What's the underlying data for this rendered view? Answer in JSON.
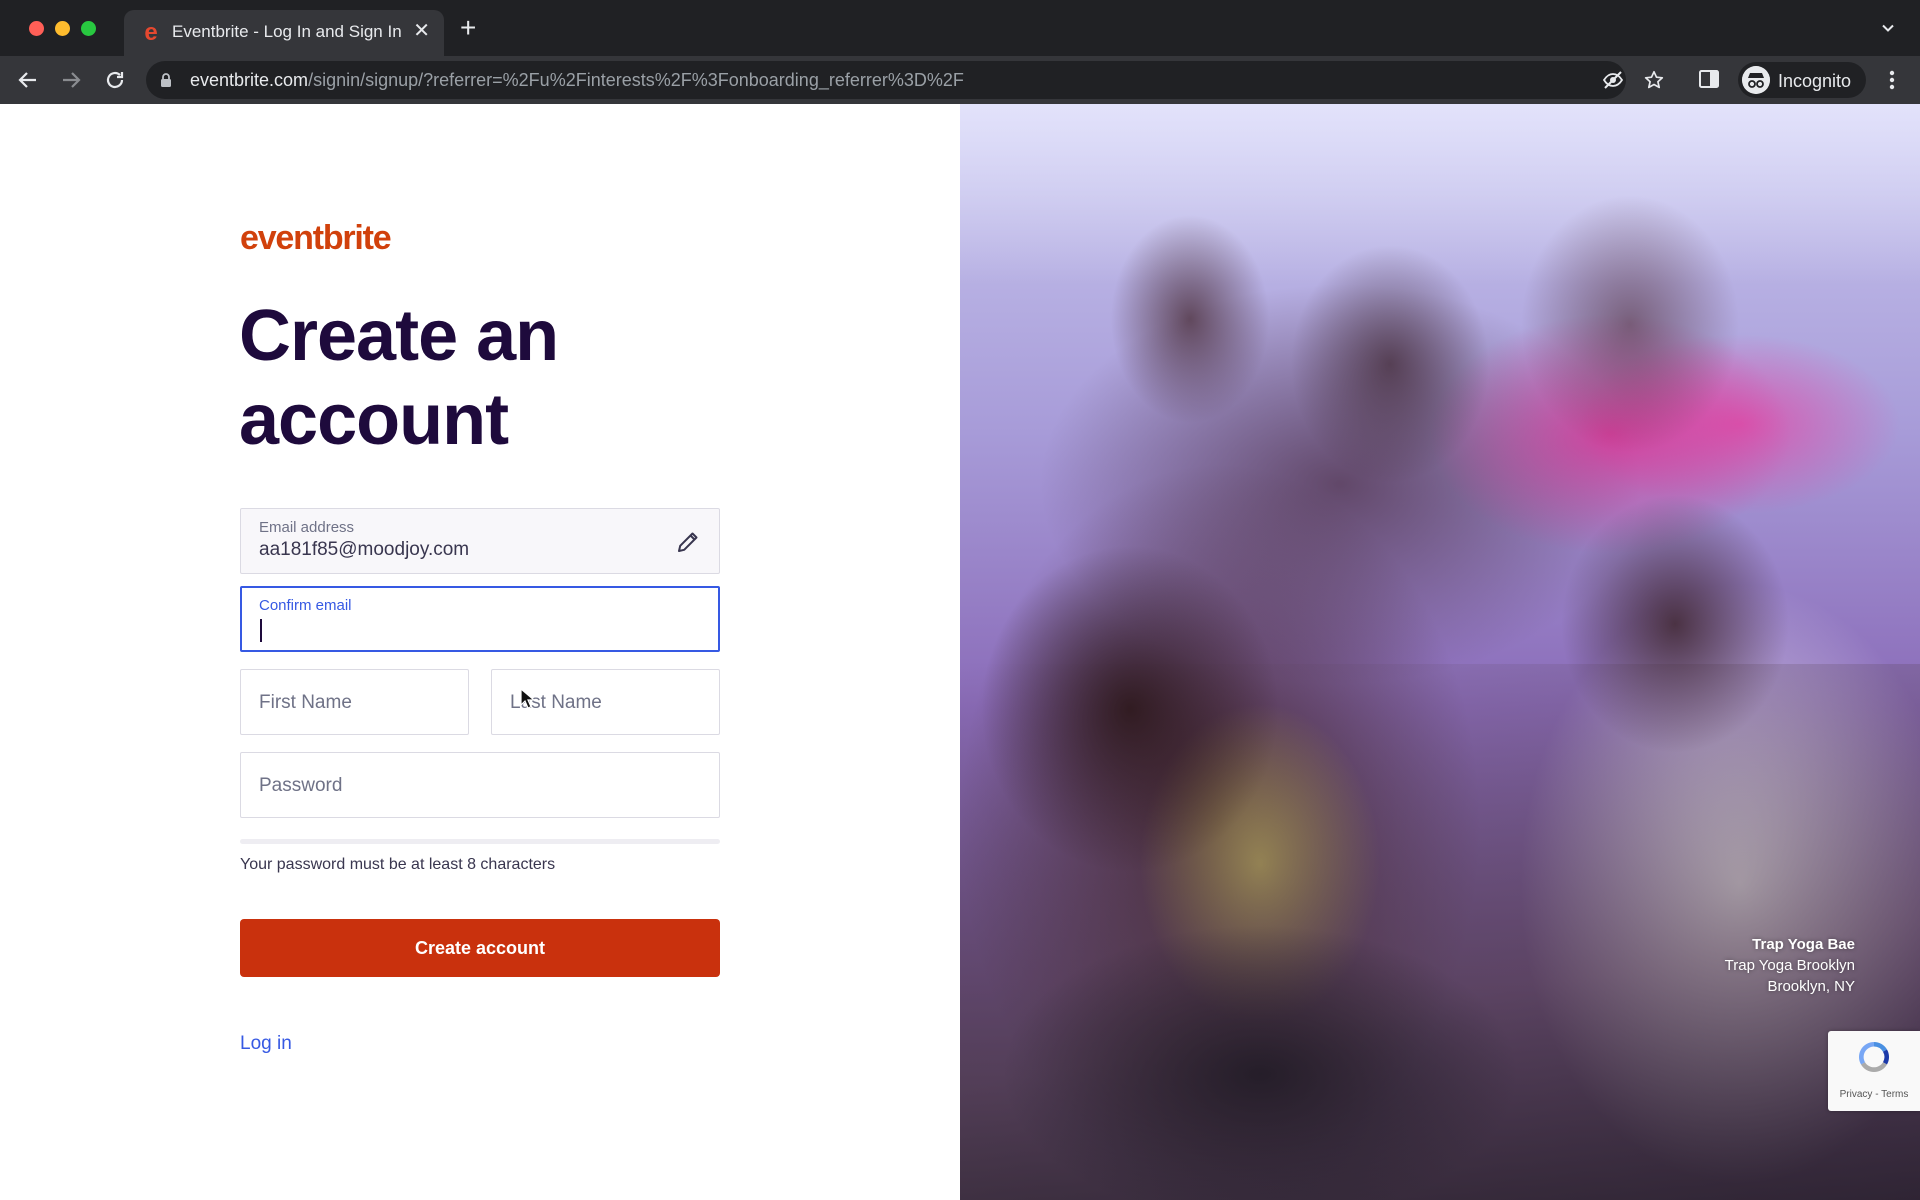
{
  "browser": {
    "tab_title": "Eventbrite - Log In and Sign In",
    "tab_favicon": "e",
    "url_host": "eventbrite.com",
    "url_path": "/signin/signup/?referrer=%2Fu%2Finterests%2F%3Fonboarding_referrer%3D%2F",
    "incognito_label": "Incognito"
  },
  "brand": {
    "logo_text": "eventbrite",
    "logo_color": "#d1410c"
  },
  "form": {
    "heading": "Create an account",
    "email_label": "Email address",
    "email_value": "aa181f85@moodjoy.com",
    "confirm_label": "Confirm email",
    "confirm_value": "",
    "first_name_placeholder": "First Name",
    "last_name_placeholder": "Last Name",
    "password_placeholder": "Password",
    "password_hint": "Your password must be at least 8 characters",
    "submit_label": "Create account",
    "login_link": "Log in",
    "accent_color": "#3659e3",
    "submit_color": "#c9310d"
  },
  "hero": {
    "caption_name": "Trap Yoga Bae",
    "caption_org": "Trap Yoga Brooklyn",
    "caption_location": "Brooklyn, NY"
  },
  "recaptcha": {
    "links": "Privacy - Terms"
  },
  "icons": {
    "back": "arrow-left-icon",
    "forward": "arrow-right-icon",
    "reload": "reload-icon",
    "lock": "lock-icon",
    "eye_off": "eye-off-icon",
    "star": "star-icon",
    "sidepanel": "side-panel-icon",
    "menu": "kebab-menu-icon",
    "edit": "pencil-icon"
  }
}
